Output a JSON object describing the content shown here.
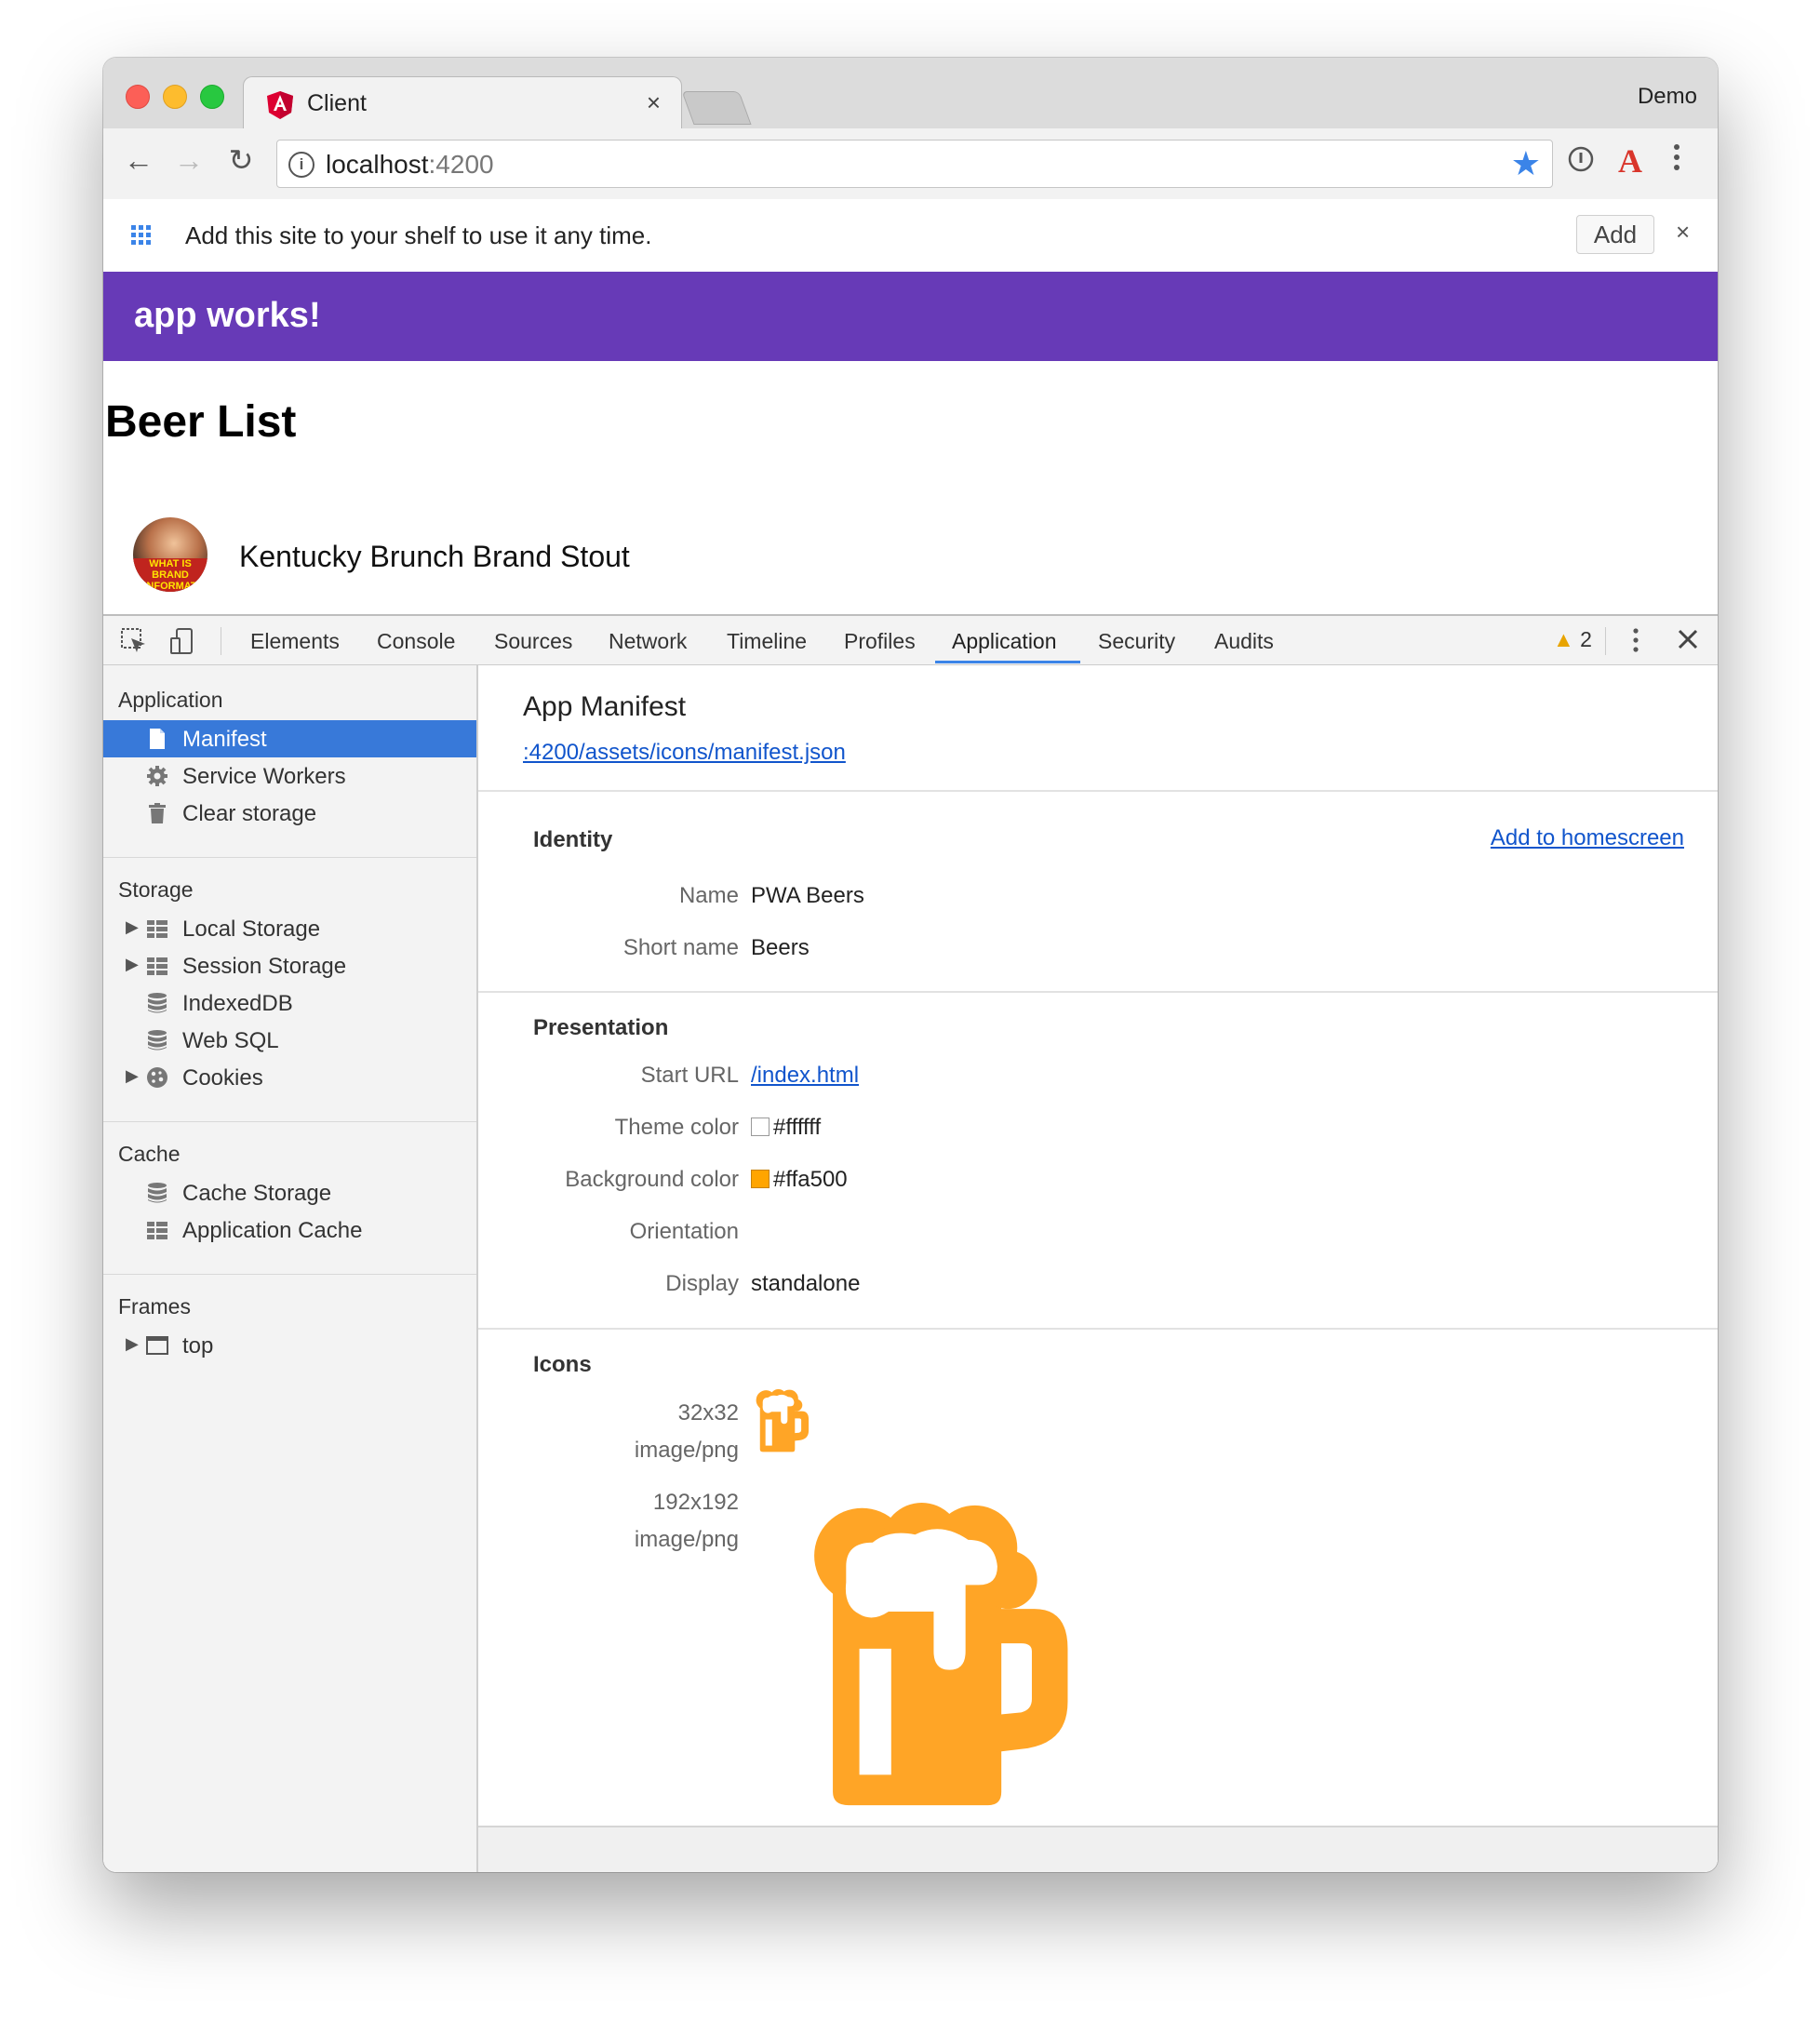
{
  "browser": {
    "tab_title": "Client",
    "tab_close": "×",
    "profile": "Demo",
    "url_host": "localhost",
    "url_port": ":4200"
  },
  "shelf": {
    "text": "Add this site to your shelf to use it any time.",
    "add_label": "Add",
    "close": "×"
  },
  "page": {
    "app_title": "app works!",
    "heading": "Beer List",
    "avatar_text": "WHAT IS BRAND INFORMAT",
    "beers": [
      "Kentucky Brunch Brand Stout"
    ]
  },
  "devtools": {
    "tabs": [
      "Elements",
      "Console",
      "Sources",
      "Network",
      "Timeline",
      "Profiles",
      "Application",
      "Security",
      "Audits"
    ],
    "active_tab": "Application",
    "warning_count": "2",
    "sidebar": {
      "application_header": "Application",
      "application_items": [
        "Manifest",
        "Service Workers",
        "Clear storage"
      ],
      "storage_header": "Storage",
      "storage_items": [
        "Local Storage",
        "Session Storage",
        "IndexedDB",
        "Web SQL",
        "Cookies"
      ],
      "cache_header": "Cache",
      "cache_items": [
        "Cache Storage",
        "Application Cache"
      ],
      "frames_header": "Frames",
      "frames_items": [
        "top"
      ]
    },
    "manifest": {
      "title": "App Manifest",
      "link": ":4200/assets/icons/manifest.json",
      "add_to_homescreen": "Add to homescreen",
      "identity_header": "Identity",
      "name_label": "Name",
      "name_value": "PWA Beers",
      "short_name_label": "Short name",
      "short_name_value": "Beers",
      "presentation_header": "Presentation",
      "start_url_label": "Start URL",
      "start_url_value": "/index.html",
      "theme_color_label": "Theme color",
      "theme_color_value": "#ffffff",
      "background_color_label": "Background color",
      "background_color_value": "#ffa500",
      "orientation_label": "Orientation",
      "display_label": "Display",
      "display_value": "standalone",
      "icons_header": "Icons",
      "icon1_size": "32x32",
      "icon1_type": "image/png",
      "icon2_size": "192x192",
      "icon2_type": "image/png"
    }
  },
  "colors": {
    "app_bar": "#673ab7",
    "selection": "#3879d9",
    "link": "#1155cc",
    "beer_icon": "#ffa526",
    "accent_blue": "#3b84e8"
  },
  "icons": [
    "angular-icon",
    "info-icon",
    "star-icon",
    "password-icon",
    "acrobat-icon",
    "menu-icon",
    "grid-icon",
    "inspect-icon",
    "device-icon",
    "warning-icon",
    "close-icon",
    "file-icon",
    "gear-icon",
    "trash-icon",
    "table-icon",
    "database-icon",
    "cookie-icon",
    "frame-icon",
    "beer-mug-icon"
  ]
}
